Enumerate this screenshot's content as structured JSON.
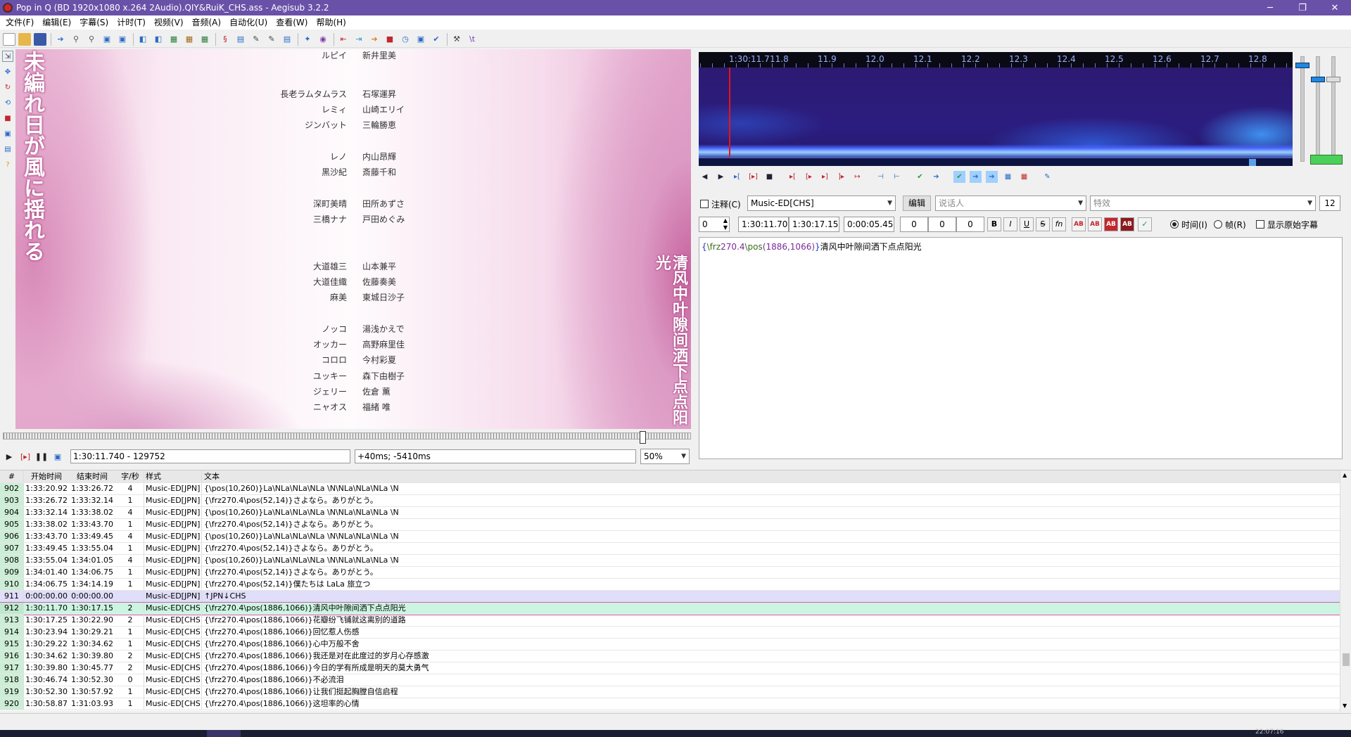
{
  "window": {
    "title": "Pop in Q (BD 1920x1080 x.264 2Audio).QIY&RuiK_CHS.ass - Aegisub 3.2.2",
    "minimize": "─",
    "maximize": "❐",
    "close": "✕"
  },
  "menu": [
    "文件(F)",
    "编辑(E)",
    "字幕(S)",
    "计时(T)",
    "视频(V)",
    "音频(A)",
    "自动化(U)",
    "查看(W)",
    "帮助(H)"
  ],
  "video": {
    "left_vertical_text": "未編れ日が風に揺れる",
    "right_vertical_text": "清风中叶隙间洒下点点阳光",
    "credits": [
      {
        "role": "ルピイ",
        "name": "新井里美"
      },
      {
        "role": "長老ラムタムラス",
        "name": "石塚運昇"
      },
      {
        "role": "レミィ",
        "name": "山崎エリイ"
      },
      {
        "role": "ジンバット",
        "name": "三輪勝恵"
      },
      {
        "role": "レノ",
        "name": "内山昂輝"
      },
      {
        "role": "黒沙紀",
        "name": "斎藤千和"
      },
      {
        "role": "深町美晴",
        "name": "田所あずさ"
      },
      {
        "role": "三橋ナナ",
        "name": "戸田めぐみ"
      },
      {
        "role": "大道雄三",
        "name": "山本兼平"
      },
      {
        "role": "大道佳織",
        "name": "佐藤奏美"
      },
      {
        "role": "麻美",
        "name": "東城日沙子"
      },
      {
        "role": "ノッコ",
        "name": "湯浅かえで"
      },
      {
        "role": "オッカー",
        "name": "高野麻里佳"
      },
      {
        "role": "コロロ",
        "name": "今村彩夏"
      },
      {
        "role": "ユッキー",
        "name": "森下由樹子"
      },
      {
        "role": "ジェリー",
        "name": "佐倉 薫"
      },
      {
        "role": "ニャオス",
        "name": "福緒 唯"
      }
    ],
    "seek_position": 0.925,
    "time_frame": "1:30:11.740 - 129752",
    "offset": "+40ms; -5410ms",
    "zoom": "50%"
  },
  "audio": {
    "ruler_labels": [
      "1:30:11.7",
      "11.8",
      "11.9",
      "12.0",
      "12.1",
      "12.2",
      "12.3",
      "12.4",
      "12.5",
      "12.6",
      "12.7",
      "12.8"
    ]
  },
  "edit": {
    "comment_label": "注释(C)",
    "style": "Music-ED[CHS]",
    "edit_button": "编辑",
    "actor_placeholder": "说话人",
    "effect_placeholder": "特效",
    "line_count": "12",
    "layer": "0",
    "start": "1:30:11.70",
    "end": "1:30:17.15",
    "duration": "0:00:05.45",
    "margin_l": "0",
    "margin_r": "0",
    "margin_v": "0",
    "bold": "B",
    "italic": "I",
    "underline": "U",
    "strike": "S",
    "fn": "fn",
    "color_buttons": [
      "AB",
      "AB",
      "AB",
      "AB"
    ],
    "commit": "✓",
    "time_label": "时间(I)",
    "frame_label": "帧(R)",
    "show_original": "显示原始字幕",
    "text": {
      "open": "{",
      "tag1": "\\frz",
      "num1": "270.4",
      "tag2": "\\pos",
      "num2": "(1886,1066)",
      "close": "}",
      "content": "清风中叶隙间洒下点点阳光"
    }
  },
  "grid": {
    "headers": {
      "num": "#",
      "start": "开始时间",
      "end": "结束时间",
      "cps": "字/秒",
      "style": "样式",
      "text": "文本"
    },
    "rows": [
      {
        "num": "902",
        "start": "1:33:20.92",
        "end": "1:33:26.72",
        "cps": "4",
        "style": "Music-ED[JPN]",
        "text": "{\\pos(10,260)}La\\NLa\\NLa\\NLa \\N\\NLa\\NLa\\NLa \\N"
      },
      {
        "num": "903",
        "start": "1:33:26.72",
        "end": "1:33:32.14",
        "cps": "1",
        "style": "Music-ED[JPN]",
        "text": "{\\frz270.4\\pos(52,14)}さよなら。ありがとう。"
      },
      {
        "num": "904",
        "start": "1:33:32.14",
        "end": "1:33:38.02",
        "cps": "4",
        "style": "Music-ED[JPN]",
        "text": "{\\pos(10,260)}La\\NLa\\NLa\\NLa \\N\\NLa\\NLa\\NLa \\N"
      },
      {
        "num": "905",
        "start": "1:33:38.02",
        "end": "1:33:43.70",
        "cps": "1",
        "style": "Music-ED[JPN]",
        "text": "{\\frz270.4\\pos(52,14)}さよなら。ありがとう。"
      },
      {
        "num": "906",
        "start": "1:33:43.70",
        "end": "1:33:49.45",
        "cps": "4",
        "style": "Music-ED[JPN]",
        "text": "{\\pos(10,260)}La\\NLa\\NLa\\NLa \\N\\NLa\\NLa\\NLa \\N"
      },
      {
        "num": "907",
        "start": "1:33:49.45",
        "end": "1:33:55.04",
        "cps": "1",
        "style": "Music-ED[JPN]",
        "text": "{\\frz270.4\\pos(52,14)}さよなら。ありがとう。"
      },
      {
        "num": "908",
        "start": "1:33:55.04",
        "end": "1:34:01.05",
        "cps": "4",
        "style": "Music-ED[JPN]",
        "text": "{\\pos(10,260)}La\\NLa\\NLa\\NLa \\N\\NLa\\NLa\\NLa \\N"
      },
      {
        "num": "909",
        "start": "1:34:01.40",
        "end": "1:34:06.75",
        "cps": "1",
        "style": "Music-ED[JPN]",
        "text": "{\\frz270.4\\pos(52,14)}さよなら。ありがとう。"
      },
      {
        "num": "910",
        "start": "1:34:06.75",
        "end": "1:34:14.19",
        "cps": "1",
        "style": "Music-ED[JPN]",
        "text": "{\\frz270.4\\pos(52,14)}僕たちは LaLa 旅立つ"
      },
      {
        "num": "911",
        "start": "0:00:00.00",
        "end": "0:00:00.00",
        "cps": "",
        "style": "Music-ED[JPN]",
        "text": "↑JPN↓CHS"
      },
      {
        "num": "912",
        "start": "1:30:11.70",
        "end": "1:30:17.15",
        "cps": "2",
        "style": "Music-ED[CHS]",
        "text": "{\\frz270.4\\pos(1886,1066)}清风中叶隙间洒下点点阳光"
      },
      {
        "num": "913",
        "start": "1:30:17.25",
        "end": "1:30:22.90",
        "cps": "2",
        "style": "Music-ED[CHS]",
        "text": "{\\frz270.4\\pos(1886,1066)}花瓣纷飞铺就这离别的道路"
      },
      {
        "num": "914",
        "start": "1:30:23.94",
        "end": "1:30:29.21",
        "cps": "1",
        "style": "Music-ED[CHS]",
        "text": "{\\frz270.4\\pos(1886,1066)}回忆惹人伤感"
      },
      {
        "num": "915",
        "start": "1:30:29.22",
        "end": "1:30:34.62",
        "cps": "1",
        "style": "Music-ED[CHS]",
        "text": "{\\frz270.4\\pos(1886,1066)}心中万般不舍"
      },
      {
        "num": "916",
        "start": "1:30:34.62",
        "end": "1:30:39.80",
        "cps": "2",
        "style": "Music-ED[CHS]",
        "text": "{\\frz270.4\\pos(1886,1066)}我还是对在此度过的岁月心存感激"
      },
      {
        "num": "917",
        "start": "1:30:39.80",
        "end": "1:30:45.77",
        "cps": "2",
        "style": "Music-ED[CHS]",
        "text": "{\\frz270.4\\pos(1886,1066)}今日的学有所成是明天的莫大勇气"
      },
      {
        "num": "918",
        "start": "1:30:46.74",
        "end": "1:30:52.30",
        "cps": "0",
        "style": "Music-ED[CHS]",
        "text": "{\\frz270.4\\pos(1886,1066)}不必流泪"
      },
      {
        "num": "919",
        "start": "1:30:52.30",
        "end": "1:30:57.92",
        "cps": "1",
        "style": "Music-ED[CHS]",
        "text": "{\\frz270.4\\pos(1886,1066)}让我们挺起胸膛自信启程"
      },
      {
        "num": "920",
        "start": "1:30:58.87",
        "end": "1:31:03.93",
        "cps": "1",
        "style": "Music-ED[CHS]",
        "text": "{\\frz270.4\\pos(1886,1066)}这坦率的心情"
      }
    ]
  },
  "taskbar": {
    "clock": "22:07:16"
  },
  "colors": {
    "titlebar": "#6a51a8",
    "active_row": "#ccf5e1",
    "comment_row": "#e0def8",
    "spectrum_bg": "#2a1a6e",
    "audio_cursor": "#e11111"
  }
}
